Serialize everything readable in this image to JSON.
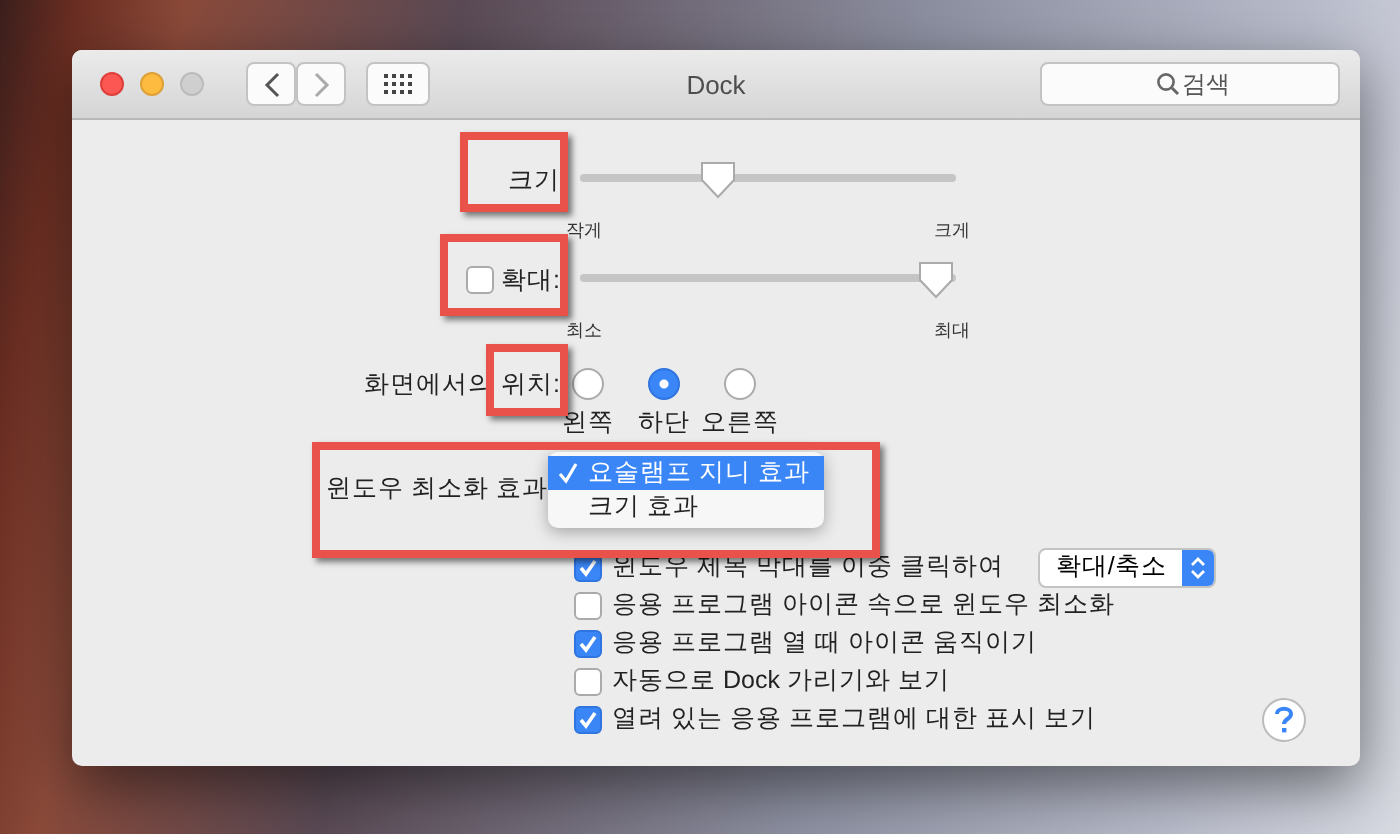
{
  "window": {
    "title": "Dock",
    "search": {
      "placeholder": "검색"
    }
  },
  "size": {
    "label": "크기",
    "level": 0.35,
    "min_label": "작게",
    "max_label": "크게"
  },
  "magnification": {
    "label": "확대:",
    "checked": false,
    "level": 1,
    "min_label": "최소",
    "max_label": "최대"
  },
  "position": {
    "label": "화면에서의 위치:",
    "options": [
      {
        "label": "왼쪽",
        "selected": false
      },
      {
        "label": "하단",
        "selected": true
      },
      {
        "label": "오른쪽",
        "selected": false
      }
    ]
  },
  "minimize_effect": {
    "label": "윈도우 최소화 효과",
    "menu": [
      {
        "label": "요술램프 지니 효과",
        "selected": true
      },
      {
        "label": "크기 효과",
        "selected": false
      }
    ]
  },
  "options": [
    {
      "label": "윈도우 제목 막대를 이중 클릭하여",
      "checked": true,
      "popup": "확대/축소"
    },
    {
      "label": "응용 프로그램 아이콘 속으로 윈도우 최소화",
      "checked": false
    },
    {
      "label": "응용 프로그램 열 때 아이콘 움직이기",
      "checked": true
    },
    {
      "label": "자동으로 Dock 가리기와 보기",
      "checked": false
    },
    {
      "label": "열려 있는 응용 프로그램에 대한 표시 보기",
      "checked": true
    }
  ]
}
